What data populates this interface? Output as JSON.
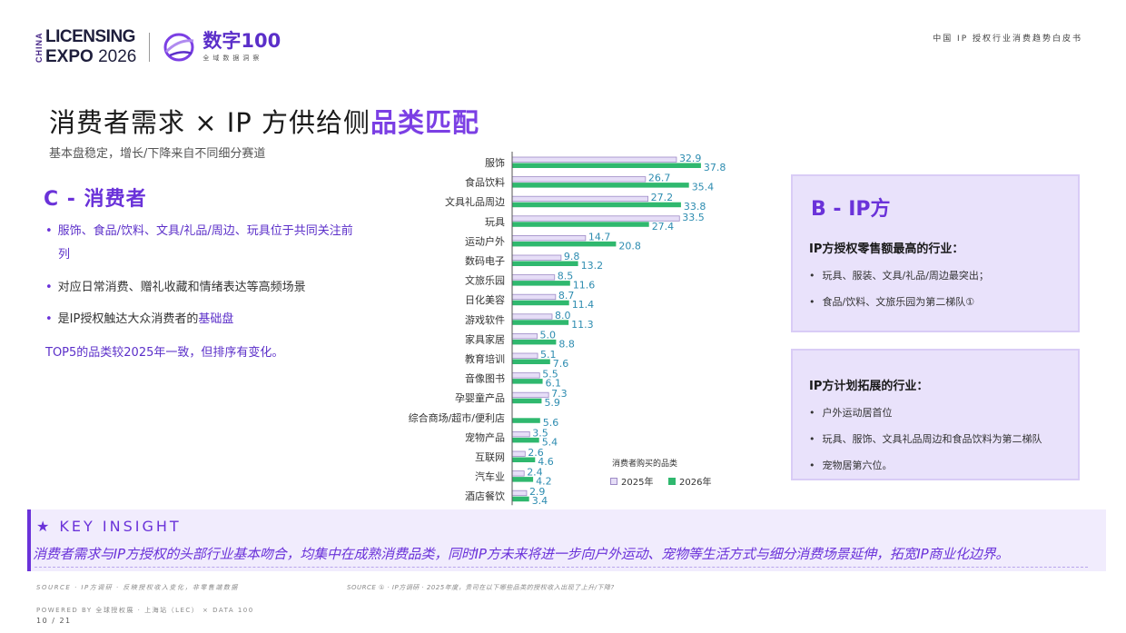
{
  "header": {
    "lic_china": "CHINA",
    "lic_line1": "LICENSING",
    "lic_line2_a": "EXPO",
    "lic_line2_b": "2026",
    "dn_title": "数字100",
    "dn_sub": "全域数据洞察",
    "report_name": "中国 IP 授权行业消费趋势白皮书"
  },
  "title": {
    "main": "消费者需求 × IP 方供给侧",
    "highlight": "品类匹配",
    "subtitle": "基本盘稳定，增长/下降来自不同细分赛道"
  },
  "consumer": {
    "title": "C - 消费者",
    "bullet1": "服饰、食品/饮料、文具/礼品/周边、玩具位于共同关注前列",
    "bullet2": "对应日常消费、赠礼收藏和情绪表达等高频场景",
    "bullet3_a": "是IP授权触达大众消费者的",
    "bullet3_b": "基础盘",
    "top5_note": "TOP5的品类较2025年一致，但排序有变化。"
  },
  "chart_data": {
    "type": "bar",
    "orientation": "horizontal",
    "categories": [
      "服饰",
      "食品饮料",
      "文具礼品周边",
      "玩具",
      "运动户外",
      "数码电子",
      "文旅乐园",
      "日化美容",
      "游戏软件",
      "家具家居",
      "教育培训",
      "音像图书",
      "孕婴童产品",
      "综合商场/超市/便利店",
      "宠物产品",
      "互联网",
      "汽车业",
      "酒店餐饮"
    ],
    "series": [
      {
        "name": "2025年",
        "values": [
          32.9,
          26.7,
          27.2,
          33.5,
          14.7,
          9.8,
          8.5,
          8.7,
          8.0,
          5.0,
          5.1,
          5.5,
          7.3,
          null,
          3.5,
          2.6,
          2.4,
          2.9
        ],
        "labels": [
          "32.9",
          "26.7",
          "27.2",
          "33.5",
          "14.7",
          "9.8",
          "8.5",
          "8.7",
          "8.0",
          "5.0",
          "5.1",
          "5.5",
          "7.3",
          "",
          "3.5",
          "2.6",
          "2.4",
          "2.9"
        ],
        "color": "#e6def7",
        "stroke": "#9d8ac6"
      },
      {
        "name": "2026年",
        "values": [
          37.8,
          35.4,
          33.8,
          27.4,
          20.8,
          13.2,
          11.6,
          11.4,
          11.3,
          8.8,
          7.6,
          6.1,
          5.9,
          5.6,
          5.4,
          4.6,
          4.2,
          3.4
        ],
        "labels": [
          "37.8",
          "35.4",
          "33.8",
          "27.4",
          "20.8",
          "13.2",
          "11.6",
          "11.4",
          "11.3",
          "8.8",
          "7.6",
          "6.1",
          "5.9",
          "5.6",
          "5.4",
          "4.6",
          "4.2",
          "3.4"
        ],
        "color": "#2fb86e"
      }
    ],
    "legend_title": "消费者购买的品类",
    "legend_labels": [
      "2025年",
      "2026年"
    ],
    "label_color": "#2d8cb0"
  },
  "ip_side": {
    "title": "B - IP方",
    "head1": "IP方授权零售额最高的行业：",
    "item1": "玩具、服装、文具/礼品/周边最突出；",
    "item2": "食品/饮料、文旅乐园为第二梯队①",
    "head2": "IP方计划拓展的行业：",
    "item3": "户外运动居首位",
    "item4": "玩具、服饰、文具礼品周边和食品饮料为第二梯队",
    "item5": "宠物居第六位。"
  },
  "insight": {
    "head": "★ KEY INSIGHT",
    "body": "消费者需求与IP方授权的头部行业基本吻合，均集中在成熟消费品类，同时IP方未来将进一步向户外运动、宠物等生活方式与细分消费场景延伸，拓宽IP商业化边界。"
  },
  "footer": {
    "source1": "SOURCE  ·  IP方调研 · 反映授权收入变化，非零售端数据",
    "source2": "SOURCE  ①  ·  IP方调研 · 2025年度，贵司在以下哪些品类的授权收入出现了上升/下降?",
    "powered": "POWERED  BY  全球授权展 · 上海站（LEC）  ×  DATA 100",
    "page": "10 / 21"
  }
}
